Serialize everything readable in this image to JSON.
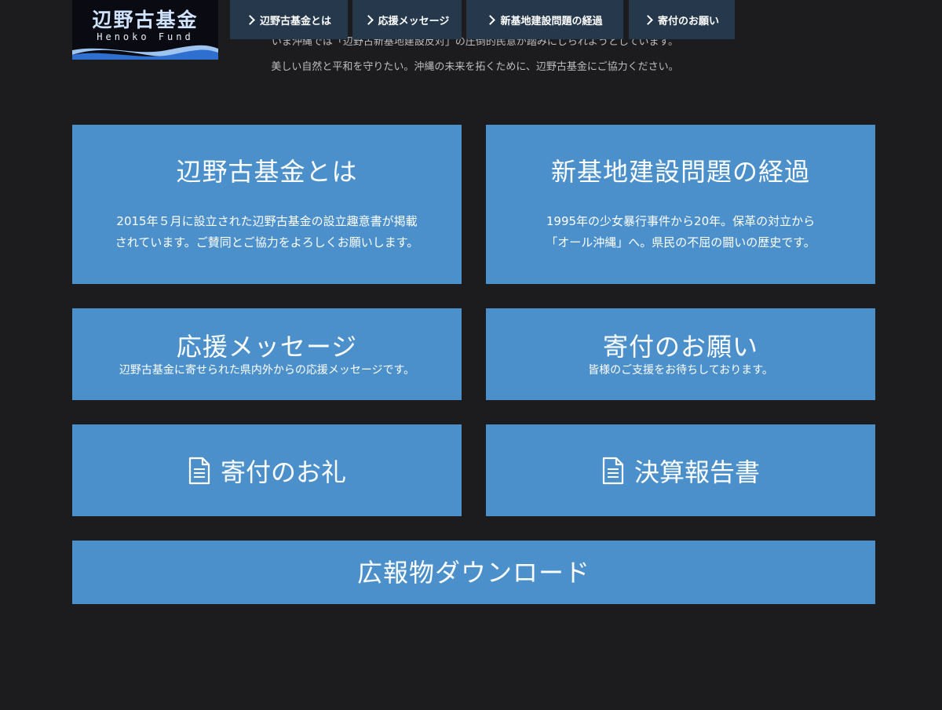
{
  "logo": {
    "title": "辺野古基金",
    "subtitle": "Henoko Fund"
  },
  "nav": {
    "items": [
      {
        "label": "辺野古基金とは"
      },
      {
        "label": "応援メッセージ"
      },
      {
        "label": "新基地建設問題の経過"
      },
      {
        "label": "寄付のお願い"
      }
    ]
  },
  "intro": {
    "line1": "いま沖縄では「辺野古新基地建設反対」の圧倒的民意が踏みにじられようとしています。",
    "line2": "美しい自然と平和を守りたい。沖縄の未来を拓くために、辺野古基金にご協力ください。"
  },
  "cards": {
    "about": {
      "title": "辺野古基金とは",
      "desc1": "2015年５月に設立された辺野古基金の設立趣意書が掲載",
      "desc2": "されています。ご賛同とご協力をよろしくお願いします。"
    },
    "history": {
      "title": "新基地建設問題の経過",
      "desc1": "1995年の少女暴行事件から20年。保革の対立から",
      "desc2": "「オール沖縄」へ。県民の不屈の闘いの歴史です。"
    },
    "messages": {
      "title": "応援メッセージ",
      "desc": "辺野古基金に寄せられた県内外からの応援メッセージです。"
    },
    "donate": {
      "title": "寄付のお願い",
      "desc": "皆様のご支援をお待ちしております。"
    },
    "thanks": {
      "title": "寄付のお礼",
      "icon": "document-icon"
    },
    "report": {
      "title": "決算報告書",
      "icon": "document-icon"
    },
    "download": {
      "title": "広報物ダウンロード"
    }
  },
  "colors": {
    "background": "#1c1c1e",
    "card": "#4b90cb",
    "nav": "#26384c",
    "logo_bg": "#0a0b12"
  }
}
